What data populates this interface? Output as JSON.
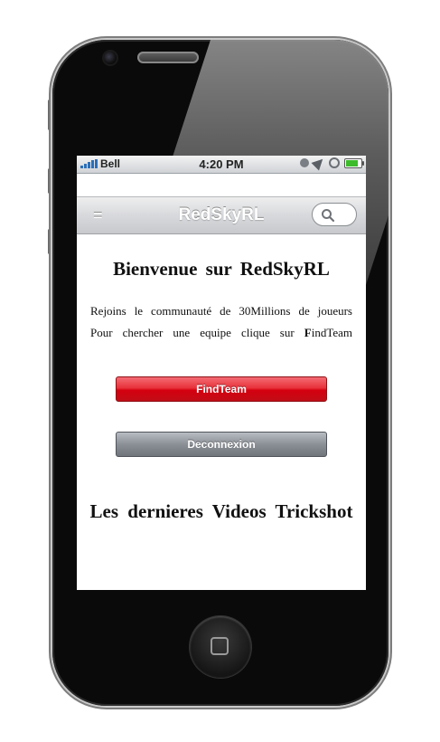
{
  "status_bar": {
    "carrier": "Bell",
    "time": "4:20 PM",
    "signal_icon": "signal-bars-icon",
    "battery_icon": "battery-icon"
  },
  "nav": {
    "title": "RedSkyRL",
    "menu_glyph": "=",
    "menu_icon": "menu-icon",
    "search_icon": "search-icon"
  },
  "main": {
    "welcome": "Bienvenue sur RedSkyRL",
    "intro_line1": "Rejoins le communauté de 30Millions de joueurs",
    "intro_line2_prefix": "Pour chercher une equipe clique sur ",
    "intro_line2_bold": "F",
    "intro_line2_suffix": "indTeam",
    "findteam_label": "FindTeam",
    "logout_label": "Deconnexion",
    "videos_heading": "Les dernieres Videos Trickshot"
  },
  "colors": {
    "findteam_button": "#d40010",
    "logout_button": "#8b9096",
    "status_signal": "#2c6fb7"
  }
}
